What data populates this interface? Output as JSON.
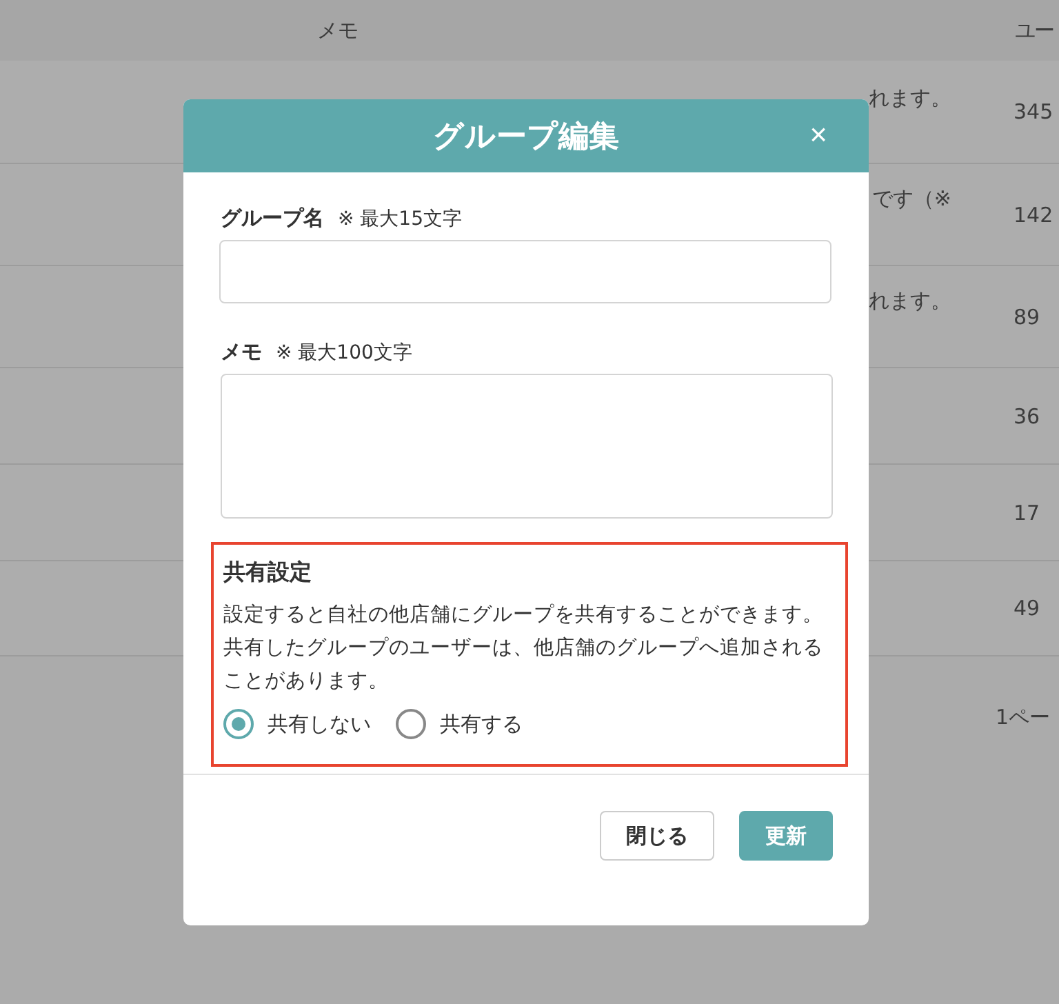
{
  "table": {
    "columns": [
      "メモ",
      "ユー"
    ],
    "rows": [
      {
        "memo": "れます。",
        "count": "345"
      },
      {
        "memo": "です（※",
        "count": "142"
      },
      {
        "memo": "れます。",
        "count": "89"
      },
      {
        "memo": "",
        "count": "36"
      },
      {
        "memo": "",
        "count": "17"
      },
      {
        "memo": "",
        "count": "49"
      }
    ],
    "pagination": "1ペー"
  },
  "dialog": {
    "title": "グループ編集",
    "close": "×",
    "fields": [
      {
        "kind": "input",
        "label": "グループ名",
        "hint": "※ 最大15文字"
      },
      {
        "kind": "textarea",
        "label": "メモ",
        "hint": "※ 最大100文字"
      }
    ],
    "share": {
      "title": "共有設定",
      "description": [
        "設定すると自社の他店舗にグループを共有することができます。",
        "共有したグループのユーザーは、他店舗のグループへ追加されることがあります。"
      ],
      "options": [
        {
          "label": "共有しない",
          "selected": true
        },
        {
          "label": "共有する",
          "selected": false
        }
      ]
    },
    "buttons": [
      {
        "label": "閉じる",
        "kind": "secondary"
      },
      {
        "label": "更新",
        "kind": "primary"
      }
    ]
  }
}
